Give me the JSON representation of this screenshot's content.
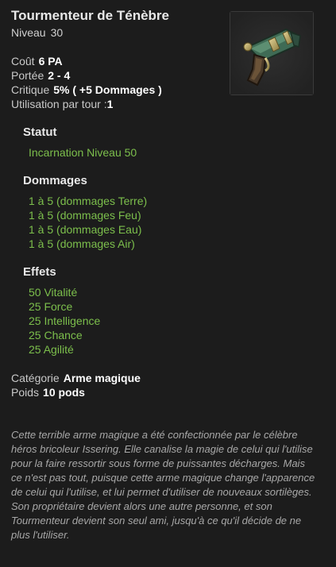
{
  "item": {
    "name": "Tourmenteur de Ténèbre",
    "level_label": "Niveau",
    "level_value": "30"
  },
  "stats": {
    "cost_label": "Coût",
    "cost_value": "6 PA",
    "range_label": "Portée",
    "range_value": "2 - 4",
    "critical_label": "Critique",
    "critical_value": "5% ( +5 Dommages )",
    "uses_label": "Utilisation par tour :",
    "uses_value": "1"
  },
  "status": {
    "heading": "Statut",
    "items": [
      "Incarnation Niveau 50"
    ]
  },
  "damage": {
    "heading": "Dommages",
    "items": [
      "1 à 5 (dommages Terre)",
      "1 à 5 (dommages Feu)",
      "1 à 5 (dommages Eau)",
      "1 à 5 (dommages Air)"
    ]
  },
  "effects": {
    "heading": "Effets",
    "items": [
      "50 Vitalité",
      "25 Force",
      "25 Intelligence",
      "25 Chance",
      "25 Agilité"
    ]
  },
  "info": {
    "category_label": "Catégorie",
    "category_value": "Arme magique",
    "weight_label": "Poids",
    "weight_value": "10 pods"
  },
  "description": "Cette terrible arme magique a été confectionnée par le célèbre héros bricoleur Issering. Elle canalise la magie de celui qui l'utilise pour la faire ressortir sous forme de puissantes décharges. Mais ce n'est pas tout, puisque cette arme magique change l'apparence de celui qui l'utilise, et lui permet d'utiliser de nouveaux sortilèges. Son propriétaire devient alors une autre personne, et son Tourmenteur devient son seul ami, jusqu'à ce qu'il décide de ne plus l'utiliser.",
  "colors": {
    "background": "#1c1c1c",
    "effect_green": "#7cbf4c",
    "value_white": "#ffffff"
  },
  "icons": {
    "item_image": "magic-pistol-weapon-icon"
  }
}
